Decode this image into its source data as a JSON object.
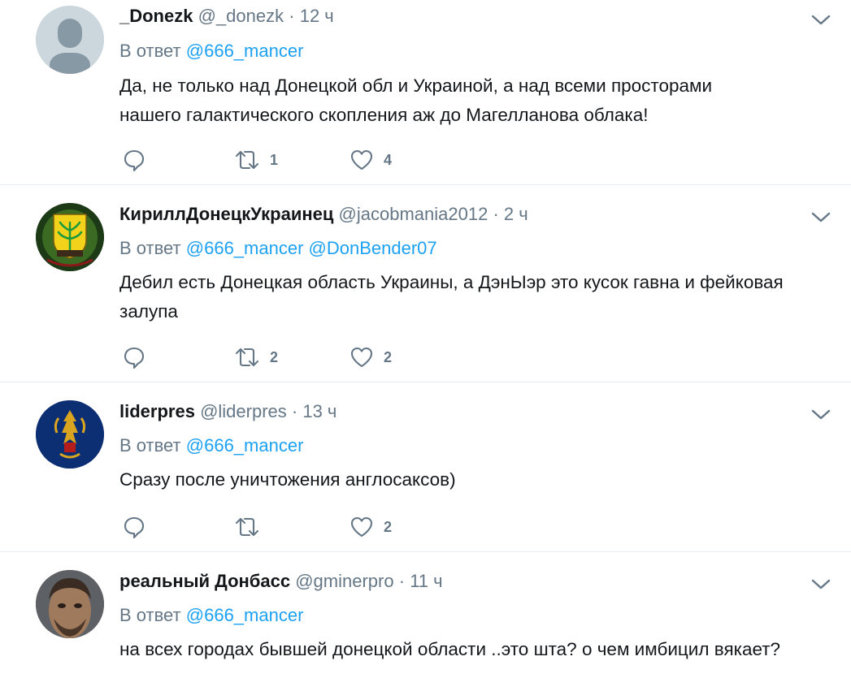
{
  "tweets": [
    {
      "name": "_Donezk",
      "handle": "@_donezk",
      "time": "12 ч",
      "reply_prefix": "В ответ",
      "mentions": [
        "@666_mancer"
      ],
      "text_lines": [
        "Да, не только над Донецкой обл и Украиной, а над всеми просторами",
        "нашего галактического скопления аж до Магелланова облака!"
      ],
      "retweets": "1",
      "likes": "4"
    },
    {
      "name": "КириллДонецкУкраинец",
      "handle": "@jacobmania2012",
      "time": "2 ч",
      "reply_prefix": "В ответ",
      "mentions": [
        "@666_mancer",
        "@DonBender07"
      ],
      "text_lines": [
        "Дебил есть Донецкая область Украины, а ДэнЫэр это кусок гавна и фейковая",
        "залупа"
      ],
      "retweets": "2",
      "likes": "2"
    },
    {
      "name": "liderpres",
      "handle": "@liderpres",
      "time": "13 ч",
      "reply_prefix": "В ответ",
      "mentions": [
        "@666_mancer"
      ],
      "text_lines": [
        "Сразу после уничтожения англосаксов)"
      ],
      "retweets": "",
      "likes": "2"
    },
    {
      "name": "реальный Донбасс",
      "handle": "@gminerpro",
      "time": "11 ч",
      "reply_prefix": "В ответ",
      "mentions": [
        "@666_mancer"
      ],
      "text_lines": [
        "на всех городах бывшей донецкой области ..это шта? о чем имбицил вякает?"
      ],
      "retweets": "",
      "likes": ""
    }
  ],
  "separator": "·",
  "icons": {
    "reply": "reply-icon",
    "retweet": "retweet-icon",
    "like": "heart-icon",
    "more": "chevron-down-icon"
  },
  "colors": {
    "accent": "#1da1f2",
    "muted": "#657786",
    "text": "#14171a",
    "border": "#e6ecf0"
  }
}
